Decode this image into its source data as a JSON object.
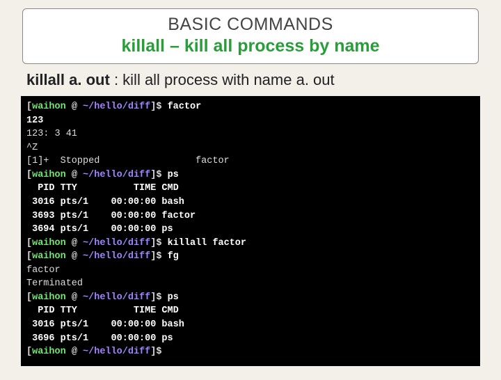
{
  "title": {
    "line1": "BASIC COMMANDS",
    "cmd": "killall",
    "sep": " – ",
    "desc": "kill all process by name"
  },
  "example": {
    "cmd": "killall a. out",
    "space": "   ",
    "desc": ": kill all process with name a. out"
  },
  "term": {
    "user": "waihon",
    "at": " @ ",
    "path": "~/hello/diff",
    "dollar": "$ ",
    "lb": "[",
    "rb": "]",
    "lines": {
      "c1": "factor",
      "l2": "123",
      "l3": "123: 3 41",
      "l4": "^Z",
      "l5a": "[1]+  Stopped                 factor",
      "c2": "ps",
      "h1": "  PID TTY          TIME CMD",
      "p1a": " 3016 pts/1    00:00:00 bash",
      "p1b": " 3693 pts/1    00:00:00 factor",
      "p1c": " 3694 pts/1    00:00:00 ps",
      "c3": "killall factor",
      "c4": "fg",
      "l11": "factor",
      "l12": "Terminated",
      "c5": "ps",
      "h2": "  PID TTY          TIME CMD",
      "p2a": " 3016 pts/1    00:00:00 bash",
      "p2b": " 3696 pts/1    00:00:00 ps",
      "c6": ""
    }
  }
}
